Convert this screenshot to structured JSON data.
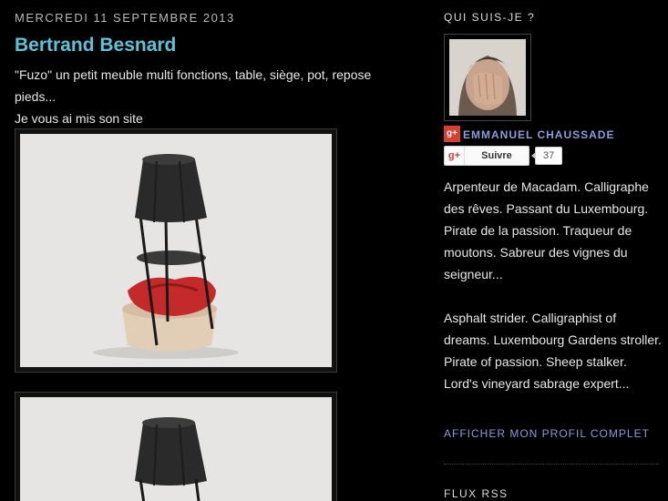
{
  "post": {
    "date": "MERCREDI 11 SEPTEMBRE 2013",
    "title": "Bertrand Besnard",
    "lines": [
      "\"Fuzo\" un petit meuble multi fonctions, table, siège, pot, repose pieds...",
      "Je vous ai mis son site"
    ]
  },
  "sidebar": {
    "about_heading": "QUI SUIS-JE ?",
    "profile_name": "EMMANUEL CHAUSSADE",
    "gplus_badge": "g+",
    "follow_label": "Suivre",
    "follow_count": "37",
    "about_fr": "Arpenteur de Macadam. Calligraphe des rêves. Passant du Luxembourg. Pirate de la passion. Traqueur de moutons. Sabreur des vignes du seigneur...",
    "about_en": "Asphalt strider. Calligraphist of dreams. Luxembourg Gardens stroller. Pirate of passion. Sheep stalker. Lord's vineyard sabrage expert...",
    "profile_link": "AFFICHER MON PROFIL COMPLET",
    "rss_heading": "FLUX RSS"
  },
  "colors": {
    "background": "#000000",
    "title": "#5ec3d9",
    "link": "#8c9bd9",
    "gplus": "#d44132"
  }
}
